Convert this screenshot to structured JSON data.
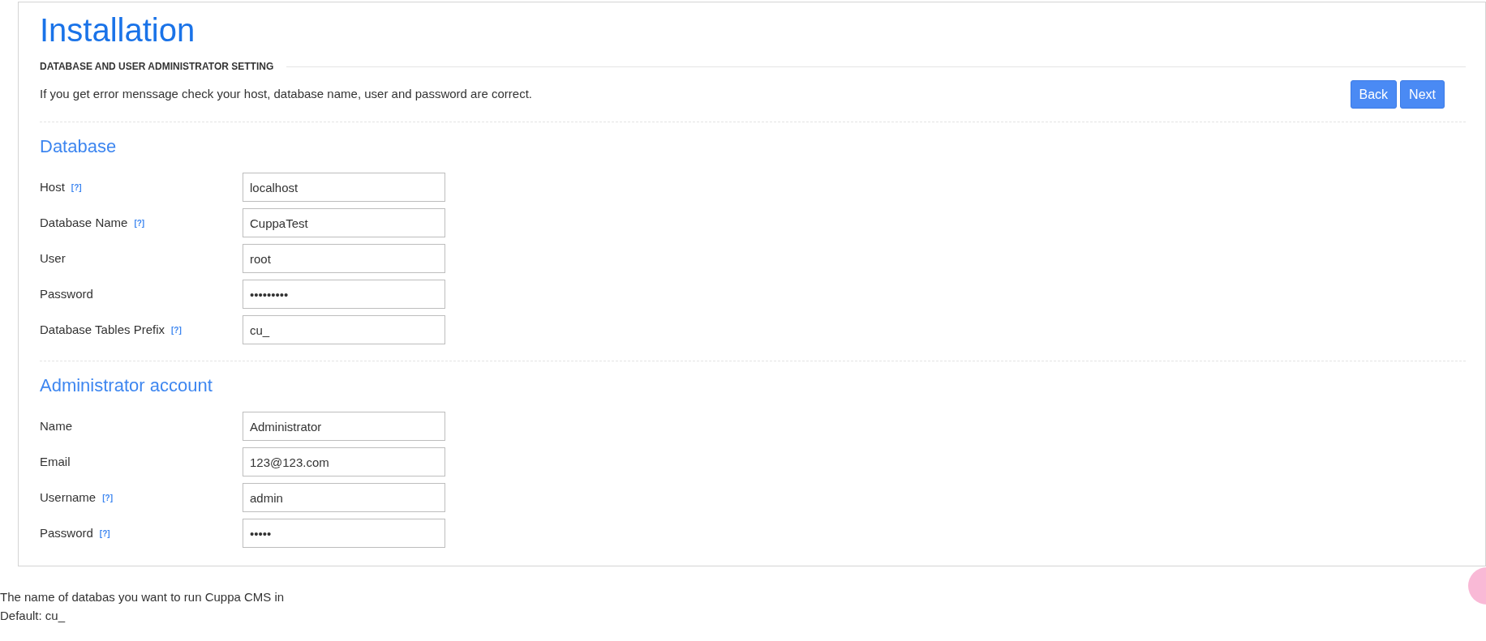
{
  "title": "Installation",
  "section_header": "DATABASE AND USER ADMINISTRATOR SETTING",
  "message": "If you get error menssage check your host, database name, user and password are correct.",
  "buttons": [
    {
      "label": "Back"
    },
    {
      "label": "Next"
    }
  ],
  "groups": [
    {
      "title": "Database",
      "fields": [
        {
          "label": "Host",
          "help": "[?]",
          "value": "localhost"
        },
        {
          "label": "Database Name",
          "help": "[?]",
          "value": "CuppaTest"
        },
        {
          "label": "User",
          "value": "root"
        },
        {
          "label": "Password",
          "value": "•••••••••"
        },
        {
          "label": "Database Tables Prefix",
          "help": "[?]",
          "value": "cu_"
        }
      ]
    },
    {
      "title": "Administrator account",
      "fields": [
        {
          "label": "Name",
          "value": "Administrator"
        },
        {
          "label": "Email",
          "value": "123@123.com"
        },
        {
          "label": "Username",
          "help": "[?]",
          "value": "admin"
        },
        {
          "label": "Password",
          "help": "[?]",
          "value": "•••••"
        }
      ]
    }
  ],
  "tooltip": [
    "The name of databas you want to run Cuppa CMS in",
    "Default: cu_"
  ]
}
